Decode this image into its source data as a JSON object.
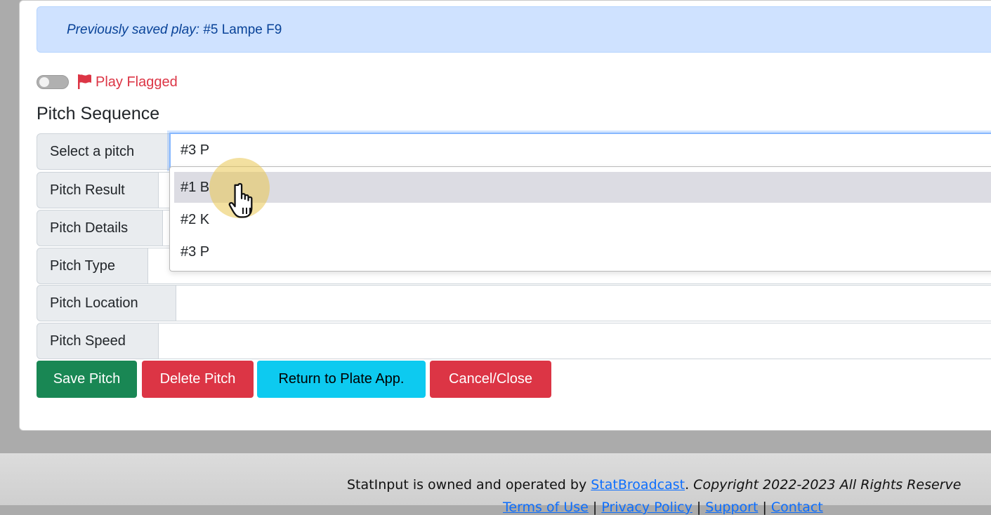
{
  "alert": {
    "label": "Previously saved play:",
    "value": "#5 Lampe F9"
  },
  "flag": {
    "icon": "flag-icon",
    "label": "Play Flagged",
    "toggle_on": false
  },
  "section_title": "Pitch Sequence",
  "fields": {
    "select_pitch": {
      "label": "Select a pitch",
      "value": "#3 P"
    },
    "pitch_result": {
      "label": "Pitch Result",
      "value": ""
    },
    "pitch_details": {
      "label": "Pitch Details",
      "value": ""
    },
    "pitch_type": {
      "label": "Pitch Type",
      "value": ""
    },
    "pitch_location": {
      "label": "Pitch Location",
      "value": ""
    },
    "pitch_speed": {
      "label": "Pitch Speed",
      "value": ""
    }
  },
  "dropdown": {
    "options": [
      "#1 B",
      "#2 K",
      "#3 P"
    ],
    "highlighted": "#1 B"
  },
  "buttons": {
    "save": "Save Pitch",
    "delete": "Delete Pitch",
    "return": "Return to Plate App.",
    "cancel": "Cancel/Close"
  },
  "footer": {
    "prefix": "StatInput is owned and operated by",
    "link": "StatBroadcast",
    "dot": ".",
    "copyright": "Copyright 2022-2023 All Rights Reserve",
    "line2": [
      "Terms of Use",
      "Privacy Policy",
      "Support",
      "Contact"
    ]
  },
  "colors": {
    "primary_alert_bg": "#cfe2ff",
    "save": "#198754",
    "danger": "#dc3545",
    "info": "#0dcaf0"
  }
}
